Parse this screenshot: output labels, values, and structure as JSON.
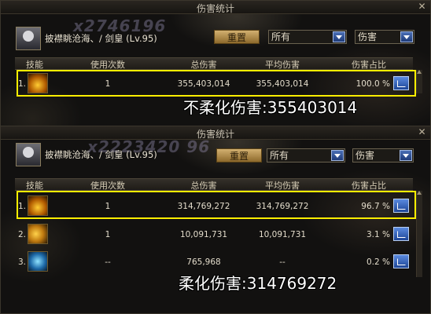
{
  "panels": [
    {
      "title": "伤害统计",
      "watermark_number": "x2746196",
      "character": "披襟眺沧海、/ 剑皇 (Lv.95)",
      "reset_label": "重置",
      "filter_scope": "所有",
      "filter_type": "伤害",
      "columns": [
        "技能",
        "使用次数",
        "总伤害",
        "平均伤害",
        "伤害占比"
      ],
      "rows": [
        {
          "index": "1.",
          "icon": "flame-burst-skill-icon",
          "uses": "1",
          "total": "355,403,014",
          "average": "355,403,014",
          "ratio": "100.0 %"
        }
      ],
      "overlay_text": "不柔化伤害:355403014"
    },
    {
      "title": "伤害统计",
      "watermark_number": "x2223420 96",
      "character": "披襟眺沧海、/ 剑皇 (Lv.95)",
      "reset_label": "重置",
      "filter_scope": "所有",
      "filter_type": "伤害",
      "columns": [
        "技能",
        "使用次数",
        "总伤害",
        "平均伤害",
        "伤害占比"
      ],
      "rows": [
        {
          "index": "1.",
          "icon": "flame-burst-skill-icon",
          "uses": "1",
          "total": "314,769,272",
          "average": "314,769,272",
          "ratio": "96.7 %"
        },
        {
          "index": "2.",
          "icon": "golden-slash-skill-icon",
          "uses": "1",
          "total": "10,091,731",
          "average": "10,091,731",
          "ratio": "3.1 %"
        },
        {
          "index": "3.",
          "icon": "blue-blade-skill-icon",
          "uses": "--",
          "total": "765,968",
          "average": "--",
          "ratio": "0.2 %"
        }
      ],
      "overlay_text": "柔化伤害:314769272"
    }
  ],
  "colors": {
    "highlight": "#ffee00",
    "accent_button": "#c9a560",
    "share_button": "#3b6ccf"
  }
}
